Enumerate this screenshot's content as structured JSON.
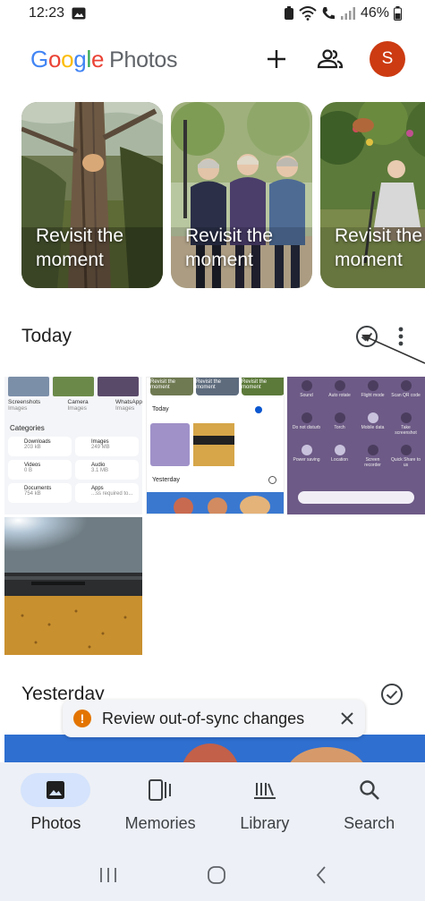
{
  "status_bar": {
    "time": "12:23",
    "battery": "46%"
  },
  "app_bar": {
    "logo_google": [
      "G",
      "o",
      "o",
      "g",
      "l",
      "e"
    ],
    "logo_photos": "Photos",
    "avatar_initial": "S"
  },
  "memories": [
    {
      "label": "Revisit the moment"
    },
    {
      "label": "Revisit the moment"
    },
    {
      "label": "Revisit the moment"
    }
  ],
  "sections": {
    "today": "Today",
    "yesterday": "Yesterday"
  },
  "thumb_files": {
    "categories_title": "Categories",
    "row_labels": [
      {
        "name": "Screenshots",
        "sub": "Images"
      },
      {
        "name": "Camera",
        "sub": "Images"
      },
      {
        "name": "WhatsApp",
        "sub": "Images"
      }
    ],
    "items": [
      {
        "name": "Downloads",
        "size": "203 kB"
      },
      {
        "name": "Images",
        "size": "249 MB"
      },
      {
        "name": "Videos",
        "size": "0 B"
      },
      {
        "name": "Audio",
        "size": "3.1 MB"
      },
      {
        "name": "Documents",
        "size": "754 kB"
      },
      {
        "name": "Apps",
        "size": "...ss required to..."
      }
    ]
  },
  "thumb_photos": {
    "today": "Today",
    "yesterday": "Yesterday",
    "memory_labels": [
      "Revisit the moment",
      "Revisit the moment",
      "Revisit the moment"
    ]
  },
  "thumb_quick": {
    "tiles": [
      [
        "Sound",
        "Auto rotate",
        "Flight mode",
        "Scan QR code"
      ],
      [
        "Do not disturb",
        "Torch",
        "Mobile data",
        "Take screenshot"
      ],
      [
        "Power saving",
        "Location",
        "Screen recorder",
        "Quick Share to us"
      ]
    ]
  },
  "toast": {
    "text": "Review out-of-sync changes"
  },
  "nav": {
    "items": [
      {
        "label": "Photos",
        "icon": "photo-icon",
        "active": true
      },
      {
        "label": "Memories",
        "icon": "memories-icon",
        "active": false
      },
      {
        "label": "Library",
        "icon": "library-icon",
        "active": false
      },
      {
        "label": "Search",
        "icon": "search-icon",
        "active": false
      }
    ]
  },
  "colors": {
    "accent": "#0b57d0",
    "avatar": "#cc3b12",
    "warning": "#e37400",
    "nav_bg": "#edf0f6",
    "nav_active_pill": "#d5e3fc"
  }
}
